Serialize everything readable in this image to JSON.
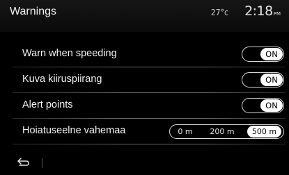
{
  "header": {
    "title": "Warnings",
    "temperature": "27°c",
    "time": "2:18",
    "ampm": "PM"
  },
  "settings": [
    {
      "label": "Warn when speeding",
      "state": "ON"
    },
    {
      "label": "Kuva kiiruspiirang",
      "state": "ON"
    },
    {
      "label": "Alert points",
      "state": "ON"
    }
  ],
  "distance_setting": {
    "label": "Hoiatuseelne vahemaa",
    "options": [
      "0 m",
      "200 m",
      "500 m"
    ],
    "selected": "500 m"
  },
  "footer": {
    "back_icon": "back-arrow-icon"
  }
}
